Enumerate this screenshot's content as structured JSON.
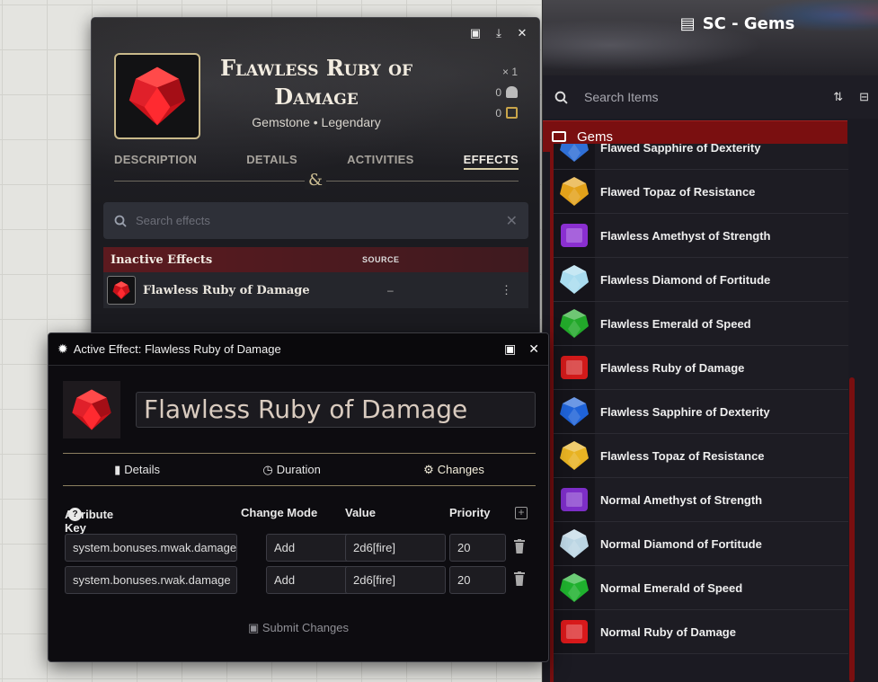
{
  "item_sheet": {
    "title": "Flawless Ruby of Damage",
    "subtitle": "Gemstone • Legendary",
    "quantity": "× 1",
    "weight": "0",
    "price": "0",
    "tabs": [
      "DESCRIPTION",
      "DETAILS",
      "ACTIVITIES",
      "EFFECTS"
    ],
    "active_tab": "EFFECTS",
    "divider_glyph": "&",
    "search_placeholder": "Search effects",
    "effects_section": {
      "label": "Inactive Effects",
      "source_header": "SOURCE"
    },
    "effect_row": {
      "name": "Flawless Ruby of Damage",
      "source": "–"
    }
  },
  "effect_dialog": {
    "window_title": "Active Effect: Flawless Ruby of Damage",
    "name": "Flawless Ruby of Damage",
    "tabs": [
      "Details",
      "Duration",
      "Changes"
    ],
    "active_tab": "Changes",
    "columns": {
      "key": "Attribute Key",
      "mode": "Change Mode",
      "value": "Value",
      "priority": "Priority"
    },
    "changes": [
      {
        "key": "system.bonuses.mwak.damage",
        "mode": "Add",
        "value": "2d6[fire]",
        "priority": "20"
      },
      {
        "key": "system.bonuses.rwak.damage",
        "mode": "Add",
        "value": "2d6[fire]",
        "priority": "20"
      }
    ],
    "submit_label": "Submit Changes"
  },
  "compendium": {
    "title": "SC - Gems",
    "search_placeholder": "Search Items",
    "folder": "Gems",
    "entries": [
      {
        "name": "Flawed Sapphire of Dexterity",
        "color": "#2f6fd6"
      },
      {
        "name": "Flawed Topaz of Resistance",
        "color": "#e3a21a"
      },
      {
        "name": "Flawless Amethyst of Strength",
        "color": "#8a2fd0"
      },
      {
        "name": "Flawless Diamond of Fortitude",
        "color": "#a9dcef"
      },
      {
        "name": "Flawless Emerald of Speed",
        "color": "#22a82a"
      },
      {
        "name": "Flawless Ruby of Damage",
        "color": "#d11a1a"
      },
      {
        "name": "Flawless Sapphire of Dexterity",
        "color": "#1f63d8"
      },
      {
        "name": "Flawless Topaz of Resistance",
        "color": "#e8b323"
      },
      {
        "name": "Normal Amethyst of Strength",
        "color": "#7d2ec8"
      },
      {
        "name": "Normal Diamond of Fortitude",
        "color": "#bcd6e4"
      },
      {
        "name": "Normal Emerald of Speed",
        "color": "#1fb12e"
      },
      {
        "name": "Normal Ruby of Damage",
        "color": "#d8191b"
      }
    ]
  },
  "colors": {
    "accent_red": "#7a0f10",
    "gold": "#c9b98a"
  }
}
